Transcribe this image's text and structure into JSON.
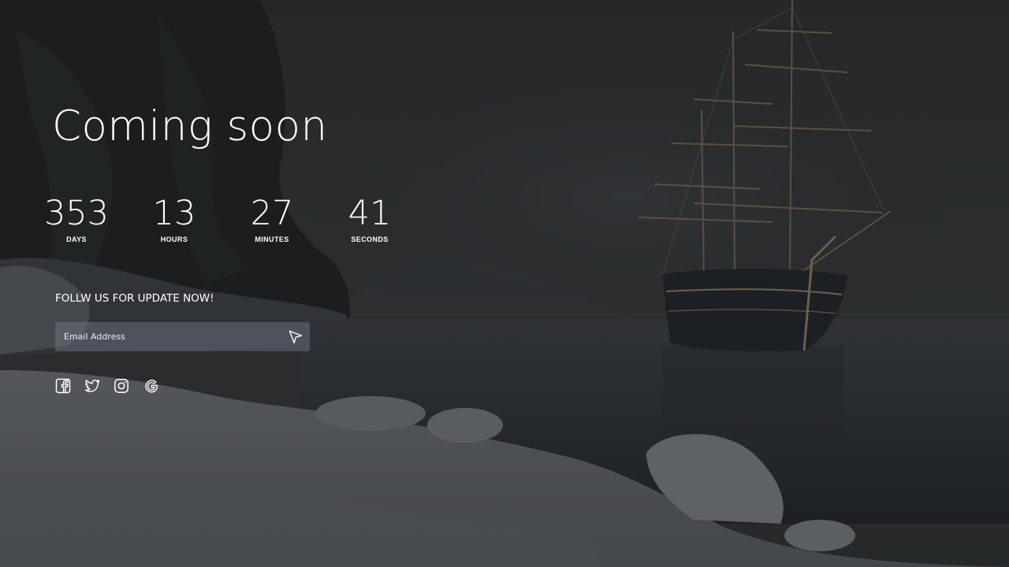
{
  "page": {
    "headline": "Coming soon"
  },
  "countdown": {
    "days": {
      "value": "353",
      "label": "DAYS"
    },
    "hours": {
      "value": "13",
      "label": "HOURS"
    },
    "minutes": {
      "value": "27",
      "label": "MINUTES"
    },
    "seconds": {
      "value": "41",
      "label": "SECONDS"
    }
  },
  "newsletter": {
    "title": "FOLLW US FOR UPDATE NOW!",
    "placeholder": "Email Address",
    "value": "",
    "submit_icon": "send-arrow-icon"
  },
  "socials": [
    {
      "icon": "facebook-icon"
    },
    {
      "icon": "twitter-icon"
    },
    {
      "icon": "instagram-icon"
    },
    {
      "icon": "google-icon"
    }
  ],
  "colors": {
    "background": "#2a2b2d",
    "text": "#ffffff",
    "input_fill": "#5a6472"
  }
}
